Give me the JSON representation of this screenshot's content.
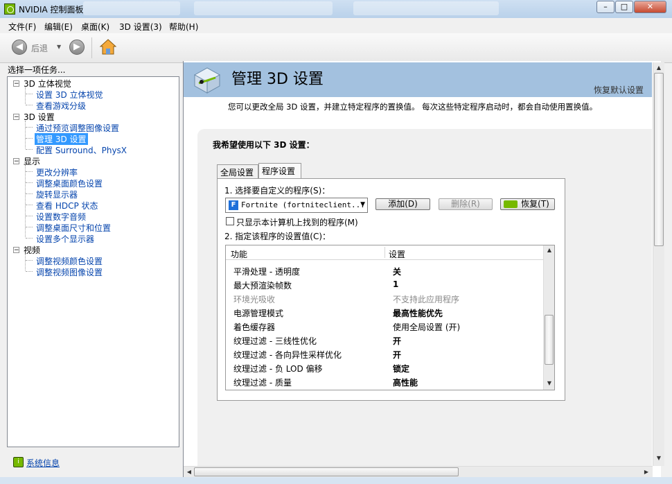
{
  "window": {
    "title": "NVIDIA 控制面板",
    "min_glyph": "–",
    "max_glyph": "□",
    "close_glyph": "✕"
  },
  "menu": [
    "文件(F)",
    "编辑(E)",
    "桌面(K)",
    "3D 设置(3)",
    "帮助(H)"
  ],
  "toolbar": {
    "back_label": "后退",
    "back_icon": "arrow-left-icon",
    "forward_icon": "arrow-right-icon",
    "home_icon": "home-icon",
    "dropdown_glyph": "▼",
    "back_glyph": "◀",
    "fwd_glyph": "▶"
  },
  "left_panel": {
    "header": "选择一项任务...",
    "tree": [
      {
        "label": "3D 立体视觉",
        "children": [
          "设置 3D 立体视觉",
          "查看游戏分级"
        ]
      },
      {
        "label": "3D 设置",
        "children": [
          "通过预览调整图像设置",
          "管理 3D 设置",
          "配置 Surround、PhysX"
        ]
      },
      {
        "label": "显示",
        "children": [
          "更改分辨率",
          "调整桌面颜色设置",
          "旋转显示器",
          "查看 HDCP 状态",
          "设置数字音频",
          "调整桌面尺寸和位置",
          "设置多个显示器"
        ]
      },
      {
        "label": "视频",
        "children": [
          "调整视频颜色设置",
          "调整视频图像设置"
        ]
      }
    ],
    "selected": "管理 3D 设置",
    "expand_glyph": "−",
    "system_info": "系统信息"
  },
  "main": {
    "title": "管理 3D 设置",
    "restore_defaults": "恢复默认设置",
    "description": "您可以更改全局 3D 设置，并建立特定程序的置换值。 每次这些特定程序启动时，都会自动使用置换值。",
    "section_title": "我希望使用以下 3D 设置：",
    "tabs": [
      "全局设置",
      "程序设置"
    ],
    "active_tab": "程序设置",
    "step1": "1. 选择要自定义的程序(S)：",
    "program": {
      "icon_letter": "F",
      "value": "Fortnite (fortniteclient...",
      "arrow": "▼"
    },
    "buttons": {
      "add": "添加(D)",
      "remove": "删除(R)",
      "restore": "恢复(T)"
    },
    "checkbox_label": "只显示本计算机上找到的程序(M)",
    "step2": "2. 指定该程序的设置值(C)：",
    "table": {
      "columns": [
        "功能",
        "设置"
      ],
      "rows": [
        {
          "feature": "平滑处理 - 透明度",
          "value": "关",
          "bold": true,
          "dim": false
        },
        {
          "feature": "最大预渲染帧数",
          "value": "1",
          "bold": true,
          "dim": false
        },
        {
          "feature": "环境光吸收",
          "value": "不支持此应用程序",
          "bold": false,
          "dim": true
        },
        {
          "feature": "电源管理模式",
          "value": "最高性能优先",
          "bold": true,
          "dim": false
        },
        {
          "feature": "着色缓存器",
          "value": "使用全局设置 (开)",
          "bold": false,
          "dim": false
        },
        {
          "feature": "纹理过滤 - 三线性优化",
          "value": "开",
          "bold": true,
          "dim": false
        },
        {
          "feature": "纹理过滤 - 各向异性采样优化",
          "value": "开",
          "bold": true,
          "dim": false
        },
        {
          "feature": "纹理过滤 - 负 LOD 偏移",
          "value": "锁定",
          "bold": true,
          "dim": false
        },
        {
          "feature": "纹理过滤 - 质量",
          "value": "高性能",
          "bold": true,
          "dim": false
        }
      ]
    }
  },
  "scroll_glyphs": {
    "up": "▲",
    "down": "▼",
    "left": "◀",
    "right": "▶",
    "grip": "≡"
  }
}
